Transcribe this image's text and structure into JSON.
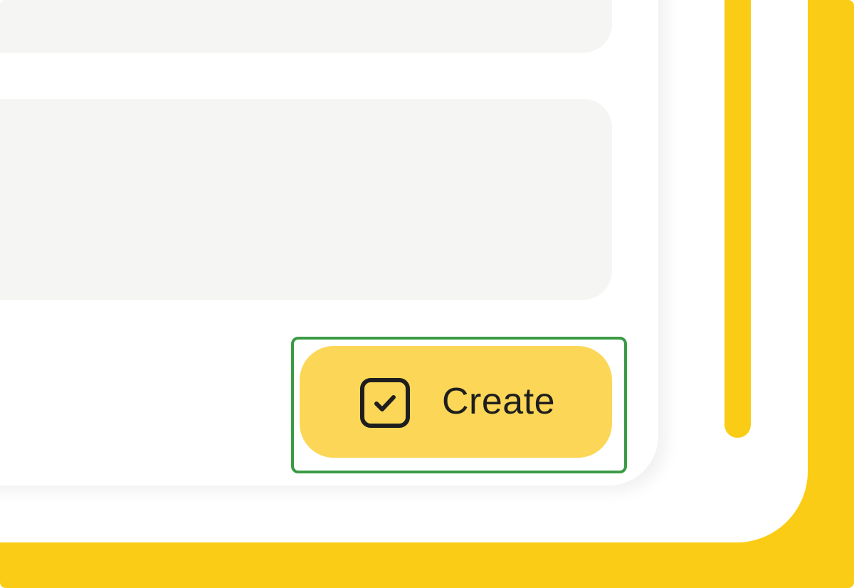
{
  "colors": {
    "accent": "#FACC15",
    "button": "#FCD757",
    "highlight": "#3A9B45",
    "field": "#F5F5F3"
  },
  "form": {
    "create_button": {
      "label": "Create",
      "icon": "checkbox-checked-icon"
    }
  }
}
